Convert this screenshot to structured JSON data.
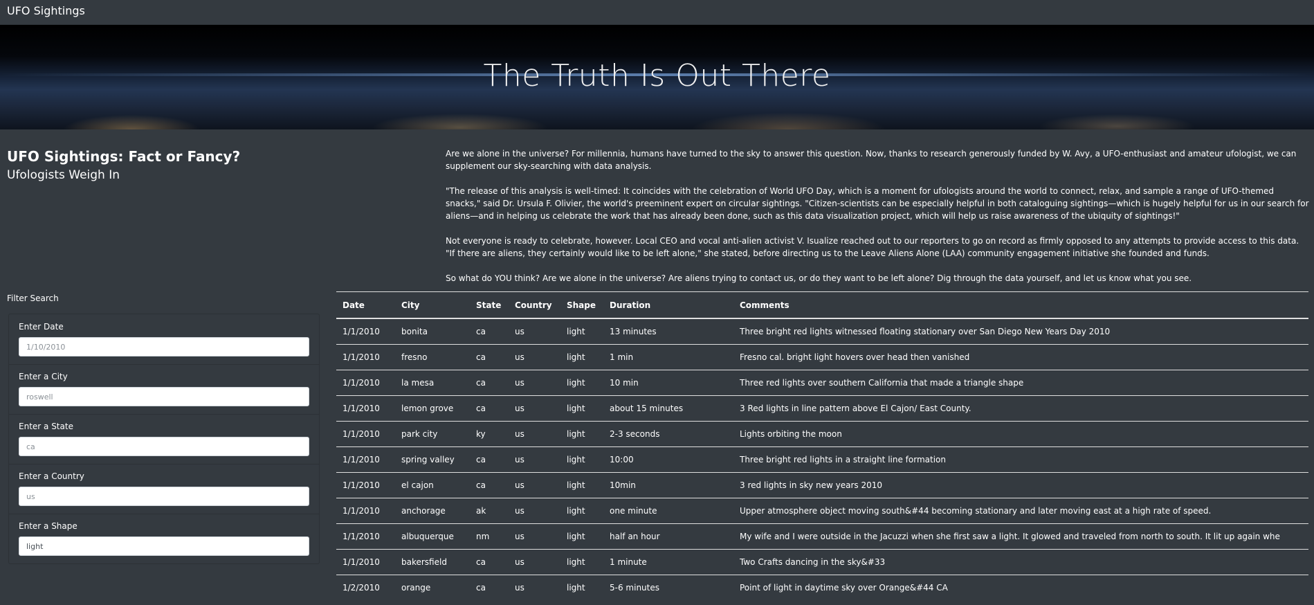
{
  "nav": {
    "brand": "UFO Sightings"
  },
  "hero": {
    "title": "The Truth Is Out There"
  },
  "intro": {
    "heading": "UFO Sightings: Fact or Fancy?",
    "subheading": "Ufologists Weigh In"
  },
  "article": {
    "paragraphs": [
      "Are we alone in the universe? For millennia, humans have turned to the sky to answer this question. Now, thanks to research generously funded by W. Avy, a UFO-enthusiast and amateur ufologist, we can supplement our sky-searching with data analysis.",
      "\"The release of this analysis is well-timed: It coincides with the celebration of World UFO Day, which is a moment for ufologists around the world to connect, relax, and sample a range of UFO-themed snacks,\" said Dr. Ursula F. Olivier, the world's preeminent expert on circular sightings. \"Citizen-scientists can be especially helpful in both cataloguing sightings—which is hugely helpful for us in our search for aliens—and in helping us celebrate the work that has already been done, such as this data visualization project, which will help us raise awareness of the ubiquity of sightings!\"",
      "Not everyone is ready to celebrate, however. Local CEO and vocal anti-alien activist V. Isualize reached out to our reporters to go on record as firmly opposed to any attempts to provide access to this data. \"If there are aliens, they certainly would like to be left alone,\" she stated, before directing us to the Leave Aliens Alone (LAA) community engagement initiative she founded and funds.",
      "So what do YOU think? Are we alone in the universe? Are aliens trying to contact us, or do they want to be left alone? Dig through the data yourself, and let us know what you see."
    ]
  },
  "filters": {
    "title": "Filter Search",
    "items": [
      {
        "label": "Enter Date",
        "placeholder": "1/10/2010",
        "value": ""
      },
      {
        "label": "Enter a City",
        "placeholder": "roswell",
        "value": ""
      },
      {
        "label": "Enter a State",
        "placeholder": "ca",
        "value": ""
      },
      {
        "label": "Enter a Country",
        "placeholder": "us",
        "value": ""
      },
      {
        "label": "Enter a Shape",
        "placeholder": "light",
        "value": "light"
      }
    ]
  },
  "table": {
    "headers": [
      "Date",
      "City",
      "State",
      "Country",
      "Shape",
      "Duration",
      "Comments"
    ],
    "rows": [
      [
        "1/1/2010",
        "bonita",
        "ca",
        "us",
        "light",
        "13 minutes",
        "Three bright red lights witnessed floating stationary over San Diego New Years Day 2010"
      ],
      [
        "1/1/2010",
        "fresno",
        "ca",
        "us",
        "light",
        "1 min",
        "Fresno cal. bright light hovers over head then vanished"
      ],
      [
        "1/1/2010",
        "la mesa",
        "ca",
        "us",
        "light",
        "10 min",
        "Three red lights over southern California that made a triangle shape"
      ],
      [
        "1/1/2010",
        "lemon grove",
        "ca",
        "us",
        "light",
        "about 15 minutes",
        "3 Red lights in line pattern above El Cajon/ East County."
      ],
      [
        "1/1/2010",
        "park city",
        "ky",
        "us",
        "light",
        "2-3 seconds",
        "Lights orbiting the moon"
      ],
      [
        "1/1/2010",
        "spring valley",
        "ca",
        "us",
        "light",
        "10:00",
        "Three bright red lights in a straight line formation"
      ],
      [
        "1/1/2010",
        "el cajon",
        "ca",
        "us",
        "light",
        "10min",
        "3 red lights in sky new years 2010"
      ],
      [
        "1/1/2010",
        "anchorage",
        "ak",
        "us",
        "light",
        "one minute",
        "Upper atmosphere object moving south&#44 becoming stationary and later moving east at a high rate of speed."
      ],
      [
        "1/1/2010",
        "albuquerque",
        "nm",
        "us",
        "light",
        "half an hour",
        "My wife and I were outside in the Jacuzzi when she first saw a light. It glowed and traveled from north to south. It lit up again whe"
      ],
      [
        "1/1/2010",
        "bakersfield",
        "ca",
        "us",
        "light",
        "1 minute",
        "Two Crafts dancing in the sky&#33"
      ],
      [
        "1/2/2010",
        "orange",
        "ca",
        "us",
        "light",
        "5-6 minutes",
        "Point of light in daytime sky over Orange&#44 CA"
      ]
    ]
  }
}
